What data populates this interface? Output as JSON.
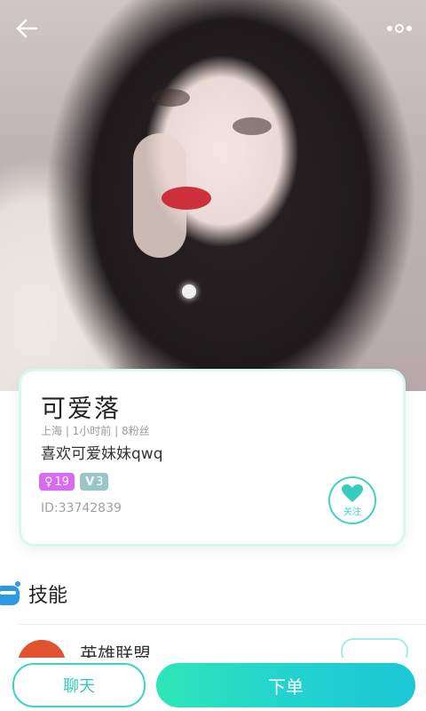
{
  "profile": {
    "name": "可爱落",
    "meta": "上海 | 1小时前 | 8粉丝",
    "bio": "喜欢可爱妹妹qwq",
    "age": "19",
    "level": "3",
    "id_text": "ID:33742839",
    "follow_label": "关注"
  },
  "skills": {
    "title": "技能",
    "items": [
      {
        "name": "英雄联盟",
        "tag": ""
      }
    ]
  },
  "bottom": {
    "chat_label": "聊天",
    "order_label": "下单"
  },
  "colors": {
    "accent": "#3fd3c0",
    "age_badge": "#d86bf0",
    "level_badge": "#9bc6c7"
  }
}
